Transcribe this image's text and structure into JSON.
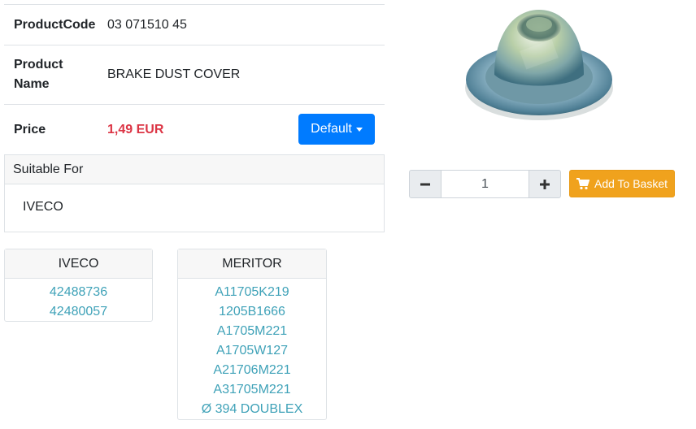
{
  "product": {
    "code_label": "ProductCode",
    "code_value": "03 071510 45",
    "name_label_line1": "Product",
    "name_label_line2": "Name",
    "name_value": "BRAKE DUST COVER",
    "price_label": "Price",
    "price_value": "1,49 EUR",
    "currency_button_label": "Default",
    "price_color": "#dc3545",
    "button_color": "#007bff"
  },
  "suitable": {
    "header": "Suitable For",
    "value": "IVECO"
  },
  "cross_refs": [
    {
      "brand": "IVECO",
      "codes": [
        "42488736",
        "42480057"
      ]
    },
    {
      "brand": "MERITOR",
      "codes": [
        "A11705K219",
        "1205B1666",
        "A1705M221",
        "A1705W127",
        "A21706M221",
        "A31705M221",
        "Ø 394 DOUBLEX"
      ]
    }
  ],
  "basket": {
    "quantity": "1",
    "add_label": "Add To Basket",
    "add_icon": "cart-icon",
    "add_color": "#f0a21d",
    "link_color": "#3fa2b8"
  },
  "image": {
    "icon": "brake-dust-cover-image"
  }
}
